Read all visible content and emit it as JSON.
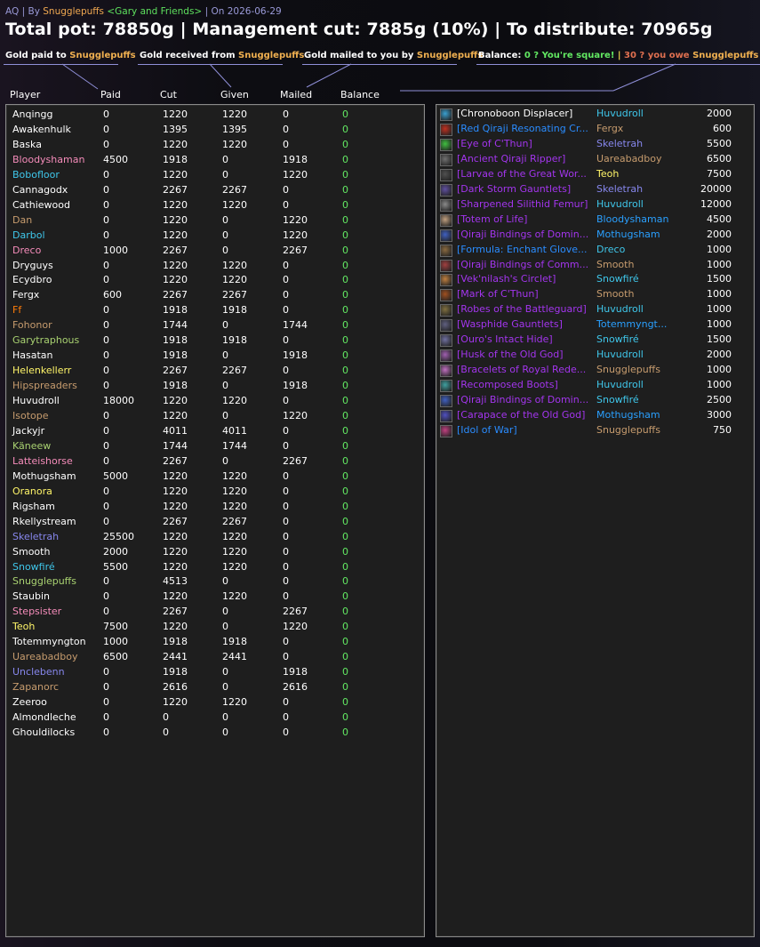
{
  "header": {
    "raid": "AQ",
    "by_label": "By",
    "leader": "Snugglepuffs",
    "guild": "<Gary and Friends>",
    "on_label": "On",
    "date": "2026-06-29",
    "title": "Total pot: 78850g | Management cut: 7885g (10%) | To distribute: 70965g"
  },
  "legend": {
    "paid_prefix": "Gold paid to",
    "paid_name": "Snugglepuffs",
    "received_prefix": "Gold received from",
    "received_name": "Snugglepuffs",
    "mailed_prefix": "Gold mailed to you by",
    "mailed_name": "Snugglepuffs",
    "balance_prefix": "Balance:",
    "balance_ok": "0 ? You're square!",
    "balance_sep": "|",
    "balance_owe_prefix": "30 ? you owe",
    "balance_owe_name": "Snugglepuffs",
    "balance_owe_amount": "30g",
    "balance_tail": "|"
  },
  "columns": {
    "player": "Player",
    "paid": "Paid",
    "cut": "Cut",
    "given": "Given",
    "mailed": "Mailed",
    "balance": "Balance"
  },
  "colors": {
    "default": "#ffffff",
    "rogue": "#fff569",
    "mage": "#3fc7eb",
    "warlock": "#8787ed",
    "priest": "#ffffff",
    "shaman": "#2aa0ff",
    "paladin": "#f58cba",
    "druid": "#ff7d0a",
    "hunter": "#a9d271",
    "warrior": "#c79c6e"
  },
  "players": [
    {
      "name": "Anqingg",
      "color": "#ffffff",
      "paid": "0",
      "cut": "1220",
      "given": "1220",
      "mailed": "0",
      "balance": "0"
    },
    {
      "name": "Awakenhulk",
      "color": "#ffffff",
      "paid": "0",
      "cut": "1395",
      "given": "1395",
      "mailed": "0",
      "balance": "0"
    },
    {
      "name": "Baska",
      "color": "#ffffff",
      "paid": "0",
      "cut": "1220",
      "given": "1220",
      "mailed": "0",
      "balance": "0"
    },
    {
      "name": "Bloodyshaman",
      "color": "#f58cba",
      "paid": "4500",
      "cut": "1918",
      "given": "0",
      "mailed": "1918",
      "balance": "0"
    },
    {
      "name": "Bobofloor",
      "color": "#3fc7eb",
      "paid": "0",
      "cut": "1220",
      "given": "0",
      "mailed": "1220",
      "balance": "0"
    },
    {
      "name": "Cannagodx",
      "color": "#ffffff",
      "paid": "0",
      "cut": "2267",
      "given": "2267",
      "mailed": "0",
      "balance": "0"
    },
    {
      "name": "Cathiewood",
      "color": "#ffffff",
      "paid": "0",
      "cut": "1220",
      "given": "1220",
      "mailed": "0",
      "balance": "0"
    },
    {
      "name": "Dan",
      "color": "#c79c6e",
      "paid": "0",
      "cut": "1220",
      "given": "0",
      "mailed": "1220",
      "balance": "0"
    },
    {
      "name": "Darbol",
      "color": "#3fc7eb",
      "paid": "0",
      "cut": "1220",
      "given": "0",
      "mailed": "1220",
      "balance": "0"
    },
    {
      "name": "Dreco",
      "color": "#f58cba",
      "paid": "1000",
      "cut": "2267",
      "given": "0",
      "mailed": "2267",
      "balance": "0"
    },
    {
      "name": "Dryguys",
      "color": "#ffffff",
      "paid": "0",
      "cut": "1220",
      "given": "1220",
      "mailed": "0",
      "balance": "0"
    },
    {
      "name": "Ecydbro",
      "color": "#ffffff",
      "paid": "0",
      "cut": "1220",
      "given": "1220",
      "mailed": "0",
      "balance": "0"
    },
    {
      "name": "Fergx",
      "color": "#ffffff",
      "paid": "600",
      "cut": "2267",
      "given": "2267",
      "mailed": "0",
      "balance": "0"
    },
    {
      "name": "Ff",
      "color": "#ff7d0a",
      "paid": "0",
      "cut": "1918",
      "given": "1918",
      "mailed": "0",
      "balance": "0"
    },
    {
      "name": "Fohonor",
      "color": "#c79c6e",
      "paid": "0",
      "cut": "1744",
      "given": "0",
      "mailed": "1744",
      "balance": "0"
    },
    {
      "name": "Garytraphous",
      "color": "#a9d271",
      "paid": "0",
      "cut": "1918",
      "given": "1918",
      "mailed": "0",
      "balance": "0"
    },
    {
      "name": "Hasatan",
      "color": "#ffffff",
      "paid": "0",
      "cut": "1918",
      "given": "0",
      "mailed": "1918",
      "balance": "0"
    },
    {
      "name": "Helenkellerr",
      "color": "#fff569",
      "paid": "0",
      "cut": "2267",
      "given": "2267",
      "mailed": "0",
      "balance": "0"
    },
    {
      "name": "Hipspreaders",
      "color": "#c79c6e",
      "paid": "0",
      "cut": "1918",
      "given": "0",
      "mailed": "1918",
      "balance": "0"
    },
    {
      "name": "Huvudroll",
      "color": "#ffffff",
      "paid": "18000",
      "cut": "1220",
      "given": "1220",
      "mailed": "0",
      "balance": "0"
    },
    {
      "name": "Isotope",
      "color": "#c79c6e",
      "paid": "0",
      "cut": "1220",
      "given": "0",
      "mailed": "1220",
      "balance": "0"
    },
    {
      "name": "Jackyjr",
      "color": "#ffffff",
      "paid": "0",
      "cut": "4011",
      "given": "4011",
      "mailed": "0",
      "balance": "0"
    },
    {
      "name": "Käneew",
      "color": "#a9d271",
      "paid": "0",
      "cut": "1744",
      "given": "1744",
      "mailed": "0",
      "balance": "0"
    },
    {
      "name": "Latteishorse",
      "color": "#f58cba",
      "paid": "0",
      "cut": "2267",
      "given": "0",
      "mailed": "2267",
      "balance": "0"
    },
    {
      "name": "Mothugsham",
      "color": "#ffffff",
      "paid": "5000",
      "cut": "1220",
      "given": "1220",
      "mailed": "0",
      "balance": "0"
    },
    {
      "name": "Oranora",
      "color": "#fff569",
      "paid": "0",
      "cut": "1220",
      "given": "1220",
      "mailed": "0",
      "balance": "0"
    },
    {
      "name": "Rigsham",
      "color": "#ffffff",
      "paid": "0",
      "cut": "1220",
      "given": "1220",
      "mailed": "0",
      "balance": "0"
    },
    {
      "name": "Rkellystream",
      "color": "#ffffff",
      "paid": "0",
      "cut": "2267",
      "given": "2267",
      "mailed": "0",
      "balance": "0"
    },
    {
      "name": "Skeletrah",
      "color": "#8787ed",
      "paid": "25500",
      "cut": "1220",
      "given": "1220",
      "mailed": "0",
      "balance": "0"
    },
    {
      "name": "Smooth",
      "color": "#ffffff",
      "paid": "2000",
      "cut": "1220",
      "given": "1220",
      "mailed": "0",
      "balance": "0"
    },
    {
      "name": "Snowfiré",
      "color": "#3fc7eb",
      "paid": "5500",
      "cut": "1220",
      "given": "1220",
      "mailed": "0",
      "balance": "0"
    },
    {
      "name": "Snugglepuffs",
      "color": "#a9d271",
      "paid": "0",
      "cut": "4513",
      "given": "0",
      "mailed": "0",
      "balance": "0"
    },
    {
      "name": "Staubin",
      "color": "#ffffff",
      "paid": "0",
      "cut": "1220",
      "given": "1220",
      "mailed": "0",
      "balance": "0"
    },
    {
      "name": "Stepsister",
      "color": "#f58cba",
      "paid": "0",
      "cut": "2267",
      "given": "0",
      "mailed": "2267",
      "balance": "0"
    },
    {
      "name": "Teoh",
      "color": "#fff569",
      "paid": "7500",
      "cut": "1220",
      "given": "0",
      "mailed": "1220",
      "balance": "0"
    },
    {
      "name": "Totemmyngton",
      "color": "#ffffff",
      "paid": "1000",
      "cut": "1918",
      "given": "1918",
      "mailed": "0",
      "balance": "0"
    },
    {
      "name": "Uareabadboy",
      "color": "#c79c6e",
      "paid": "6500",
      "cut": "2441",
      "given": "2441",
      "mailed": "0",
      "balance": "0"
    },
    {
      "name": "Unclebenn",
      "color": "#8787ed",
      "paid": "0",
      "cut": "1918",
      "given": "0",
      "mailed": "1918",
      "balance": "0"
    },
    {
      "name": "Zapanorc",
      "color": "#c79c6e",
      "paid": "0",
      "cut": "2616",
      "given": "0",
      "mailed": "2616",
      "balance": "0"
    },
    {
      "name": "Zeeroo",
      "color": "#ffffff",
      "paid": "0",
      "cut": "1220",
      "given": "1220",
      "mailed": "0",
      "balance": "0"
    },
    {
      "name": "Almondleche",
      "color": "#ffffff",
      "paid": "0",
      "cut": "0",
      "given": "0",
      "mailed": "0",
      "balance": "0"
    },
    {
      "name": "Ghouldilocks",
      "color": "#ffffff",
      "paid": "0",
      "cut": "0",
      "given": "0",
      "mailed": "0",
      "balance": "0"
    }
  ],
  "items": [
    {
      "item": "[Chronoboon Displacer]",
      "item_color": "#ffffff",
      "icon": "displacer-icon",
      "icon_color": "#3aa0d0",
      "buyer": "Huvudroll",
      "buyer_color": "#3fc7eb",
      "price": "2000"
    },
    {
      "item": "[Red Qiraji Resonating Cr...",
      "item_color": "#2a8cff",
      "icon": "red-crystal-icon",
      "icon_color": "#c03020",
      "buyer": "Fergx",
      "buyer_color": "#c79c6e",
      "price": "600"
    },
    {
      "item": "[Eye of C'Thun]",
      "item_color": "#a335ee",
      "icon": "eye-icon",
      "icon_color": "#40c040",
      "buyer": "Skeletrah",
      "buyer_color": "#8787ed",
      "price": "5500"
    },
    {
      "item": "[Ancient Qiraji Ripper]",
      "item_color": "#a335ee",
      "icon": "sword-icon",
      "icon_color": "#707070",
      "buyer": "Uareabadboy",
      "buyer_color": "#c79c6e",
      "price": "6500"
    },
    {
      "item": "[Larvae of the Great Wor...",
      "item_color": "#a335ee",
      "icon": "larvae-icon",
      "icon_color": "#505050",
      "buyer": "Teoh",
      "buyer_color": "#fff569",
      "price": "7500"
    },
    {
      "item": "[Dark Storm Gauntlets]",
      "item_color": "#a335ee",
      "icon": "gauntlets-icon",
      "icon_color": "#6050a0",
      "buyer": "Skeletrah",
      "buyer_color": "#8787ed",
      "price": "20000"
    },
    {
      "item": "[Sharpened Silithid Femur]",
      "item_color": "#a335ee",
      "icon": "femur-icon",
      "icon_color": "#8a8a8a",
      "buyer": "Huvudroll",
      "buyer_color": "#3fc7eb",
      "price": "12000"
    },
    {
      "item": "[Totem of Life]",
      "item_color": "#a335ee",
      "icon": "totem-icon",
      "icon_color": "#c0a080",
      "buyer": "Bloodyshaman",
      "buyer_color": "#2aa0ff",
      "price": "4500"
    },
    {
      "item": "[Qiraji Bindings of Domin...",
      "item_color": "#a335ee",
      "icon": "bindings-icon",
      "icon_color": "#4060c0",
      "buyer": "Mothugsham",
      "buyer_color": "#2aa0ff",
      "price": "2000"
    },
    {
      "item": "[Formula: Enchant Glove...",
      "item_color": "#2a8cff",
      "icon": "formula-icon",
      "icon_color": "#8a6a40",
      "buyer": "Dreco",
      "buyer_color": "#3fc7eb",
      "price": "1000"
    },
    {
      "item": "[Qiraji Bindings of Comm...",
      "item_color": "#a335ee",
      "icon": "bindings-icon",
      "icon_color": "#a04040",
      "buyer": "Smooth",
      "buyer_color": "#c79c6e",
      "price": "1000"
    },
    {
      "item": "[Vek'nilash's Circlet]",
      "item_color": "#a335ee",
      "icon": "circlet-icon",
      "icon_color": "#c08040",
      "buyer": "Snowfiré",
      "buyer_color": "#3fc7eb",
      "price": "1500"
    },
    {
      "item": "[Mark of C'Thun]",
      "item_color": "#a335ee",
      "icon": "mark-icon",
      "icon_color": "#a05020",
      "buyer": "Smooth",
      "buyer_color": "#c79c6e",
      "price": "1000"
    },
    {
      "item": "[Robes of the Battleguard]",
      "item_color": "#a335ee",
      "icon": "robe-icon",
      "icon_color": "#807040",
      "buyer": "Huvudroll",
      "buyer_color": "#3fc7eb",
      "price": "1000"
    },
    {
      "item": "[Wasphide Gauntlets]",
      "item_color": "#a335ee",
      "icon": "gauntlets-icon",
      "icon_color": "#606080",
      "buyer": "Totemmyngt...",
      "buyer_color": "#2aa0ff",
      "price": "1000"
    },
    {
      "item": "[Ouro's Intact Hide]",
      "item_color": "#a335ee",
      "icon": "hide-icon",
      "icon_color": "#7070a0",
      "buyer": "Snowfiré",
      "buyer_color": "#3fc7eb",
      "price": "1500"
    },
    {
      "item": "[Husk of the Old God]",
      "item_color": "#a335ee",
      "icon": "husk-icon",
      "icon_color": "#a060b0",
      "buyer": "Huvudroll",
      "buyer_color": "#3fc7eb",
      "price": "2000"
    },
    {
      "item": "[Bracelets of Royal Rede...",
      "item_color": "#a335ee",
      "icon": "bracelets-icon",
      "icon_color": "#c070c0",
      "buyer": "Snugglepuffs",
      "buyer_color": "#c79c6e",
      "price": "1000"
    },
    {
      "item": "[Recomposed Boots]",
      "item_color": "#a335ee",
      "icon": "boots-icon",
      "icon_color": "#40a0a0",
      "buyer": "Huvudroll",
      "buyer_color": "#3fc7eb",
      "price": "1000"
    },
    {
      "item": "[Qiraji Bindings of Domin...",
      "item_color": "#a335ee",
      "icon": "bindings-icon",
      "icon_color": "#4060c0",
      "buyer": "Snowfiré",
      "buyer_color": "#3fc7eb",
      "price": "2500"
    },
    {
      "item": "[Carapace of the Old God]",
      "item_color": "#a335ee",
      "icon": "carapace-icon",
      "icon_color": "#5050c0",
      "buyer": "Mothugsham",
      "buyer_color": "#2aa0ff",
      "price": "3000"
    },
    {
      "item": "[Idol of War]",
      "item_color": "#2a8cff",
      "icon": "idol-icon",
      "icon_color": "#c04080",
      "buyer": "Snugglepuffs",
      "buyer_color": "#c79c6e",
      "price": "750"
    }
  ]
}
